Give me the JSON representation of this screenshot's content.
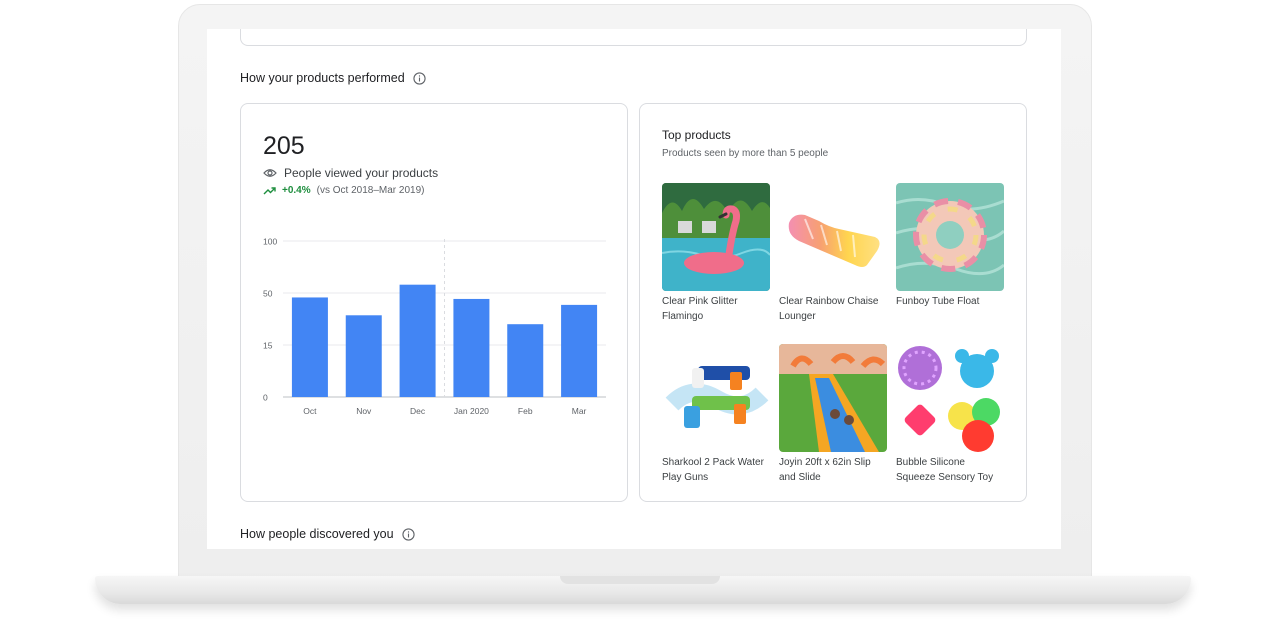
{
  "performance": {
    "section_title": "How your products performed",
    "total_views": "205",
    "views_label": "People viewed your products",
    "trend_value": "+0.4%",
    "trend_comparison": "(vs Oct 2018–Mar 2019)"
  },
  "chart_data": {
    "type": "bar",
    "categories": [
      "Oct",
      "Nov",
      "Dec",
      "Jan 2020",
      "Feb",
      "Mar"
    ],
    "values": [
      47,
      35,
      58,
      46,
      29,
      42
    ],
    "y_tick_labels": [
      "0",
      "15",
      "50",
      "100"
    ],
    "color": "#4285f4"
  },
  "top_products": {
    "title": "Top products",
    "subtitle": "Products seen by more than 5 people",
    "items": [
      {
        "name": "Clear Pink Glitter Flamingo",
        "icon": "flamingo-float-icon"
      },
      {
        "name": "Clear Rainbow Chaise Lounger",
        "icon": "chaise-lounger-icon"
      },
      {
        "name": "Funboy Tube Float",
        "icon": "tube-float-icon"
      },
      {
        "name": "Sharkool 2 Pack Water Play Guns",
        "icon": "water-gun-icon"
      },
      {
        "name": "Joyin 20ft x 62in Slip and Slide",
        "icon": "slip-and-slide-icon"
      },
      {
        "name": "Bubble Silicone Squeeze Sensory Toy",
        "icon": "sensory-toy-icon"
      }
    ]
  },
  "discovery": {
    "section_title": "How people discovered you"
  }
}
